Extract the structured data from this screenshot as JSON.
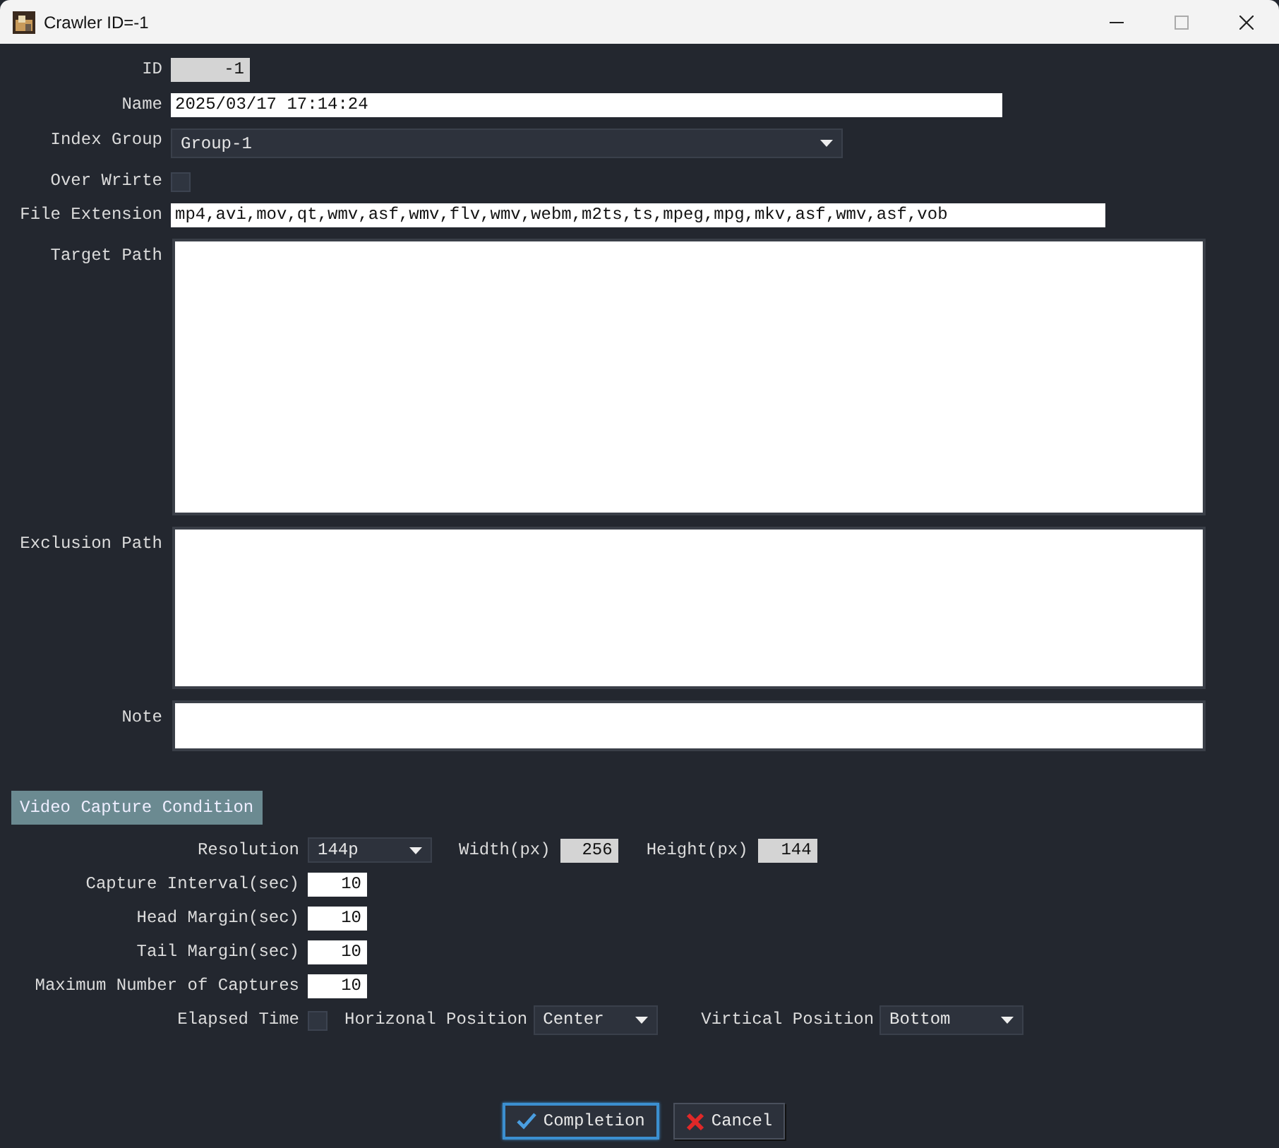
{
  "window": {
    "title": "Crawler ID=-1"
  },
  "form": [
    {
      "kind": "readonly",
      "label": "ID",
      "value": "-1"
    },
    {
      "kind": "text",
      "label": "Name",
      "value": "2025/03/17 17:14:24"
    },
    {
      "kind": "dropdown",
      "label": "Index Group",
      "value": "Group-1"
    },
    {
      "kind": "checkbox",
      "label": "Over Wrirte",
      "checked": false
    },
    {
      "kind": "text",
      "label": "File Extension",
      "value": "mp4,avi,mov,qt,wmv,asf,wmv,flv,wmv,webm,m2ts,ts,mpeg,mpg,mkv,asf,wmv,asf,vob"
    },
    {
      "kind": "textarea",
      "label": "Target Path"
    },
    {
      "kind": "textarea",
      "label": "Exclusion Path"
    },
    {
      "kind": "textarea",
      "label": "Note"
    }
  ],
  "section_tab": {
    "label": "Video Capture Condition"
  },
  "capture_rows": [
    {
      "items": [
        {
          "kind": "dropdown",
          "label": "Resolution",
          "value": "144p"
        },
        {
          "kind": "readonly",
          "label": "Width(px)",
          "value": "256"
        },
        {
          "kind": "readonly",
          "label": "Height(px)",
          "value": "144"
        }
      ]
    },
    {
      "items": [
        {
          "kind": "number",
          "label": "Capture Interval(sec)",
          "value": "10"
        }
      ]
    },
    {
      "items": [
        {
          "kind": "number",
          "label": "Head Margin(sec)",
          "value": "10"
        }
      ]
    },
    {
      "items": [
        {
          "kind": "number",
          "label": "Tail Margin(sec)",
          "value": "10"
        }
      ]
    },
    {
      "items": [
        {
          "kind": "number",
          "label": "Maximum Number of Captures",
          "value": "10"
        }
      ]
    },
    {
      "items": [
        {
          "kind": "checkbox",
          "label": "Elapsed Time",
          "checked": false
        },
        {
          "kind": "dropdown",
          "label": "Horizonal Position",
          "value": "Center"
        },
        {
          "kind": "dropdown",
          "label": "Virtical Position",
          "value": "Bottom"
        }
      ]
    }
  ],
  "buttons": [
    {
      "kind": "confirm",
      "label": "Completion",
      "focused": true
    },
    {
      "kind": "cancel",
      "label": "Cancel",
      "focused": false
    }
  ]
}
